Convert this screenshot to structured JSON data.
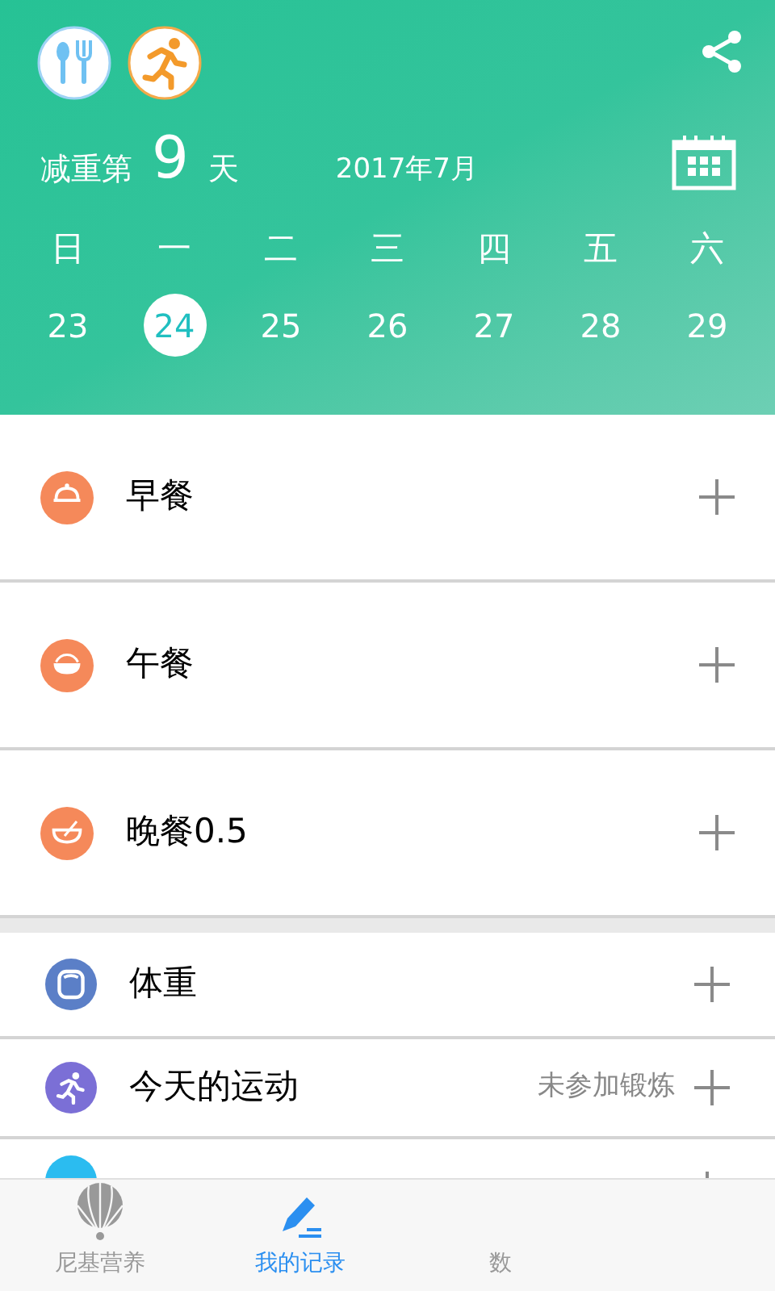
{
  "header": {
    "streak_prefix": "减重第",
    "streak_days": "9",
    "streak_suffix": "天",
    "month": "2017年7月"
  },
  "week": [
    {
      "weekday": "日",
      "date": "23",
      "selected": false
    },
    {
      "weekday": "一",
      "date": "24",
      "selected": true
    },
    {
      "weekday": "二",
      "date": "25",
      "selected": false
    },
    {
      "weekday": "三",
      "date": "26",
      "selected": false
    },
    {
      "weekday": "四",
      "date": "27",
      "selected": false
    },
    {
      "weekday": "五",
      "date": "28",
      "selected": false
    },
    {
      "weekday": "六",
      "date": "29",
      "selected": false
    }
  ],
  "meals": [
    {
      "kind": "breakfast",
      "label": "早餐"
    },
    {
      "kind": "lunch",
      "label": "午餐"
    },
    {
      "kind": "dinner",
      "label": "晚餐0.5"
    }
  ],
  "records": [
    {
      "kind": "weight",
      "label": "体重",
      "color": "#5b7fc7"
    },
    {
      "kind": "exercise",
      "label": "今天的运动",
      "status": "未参加锻炼",
      "color": "#7b6fd6"
    },
    {
      "kind": "other",
      "color": "#2bbcf0"
    }
  ],
  "tabs": [
    {
      "kind": "nutrition",
      "label": "尼基营养",
      "selected": false
    },
    {
      "kind": "records",
      "label": "我的记录",
      "selected": true
    },
    {
      "kind": "data",
      "label": "数",
      "selected": false
    }
  ]
}
